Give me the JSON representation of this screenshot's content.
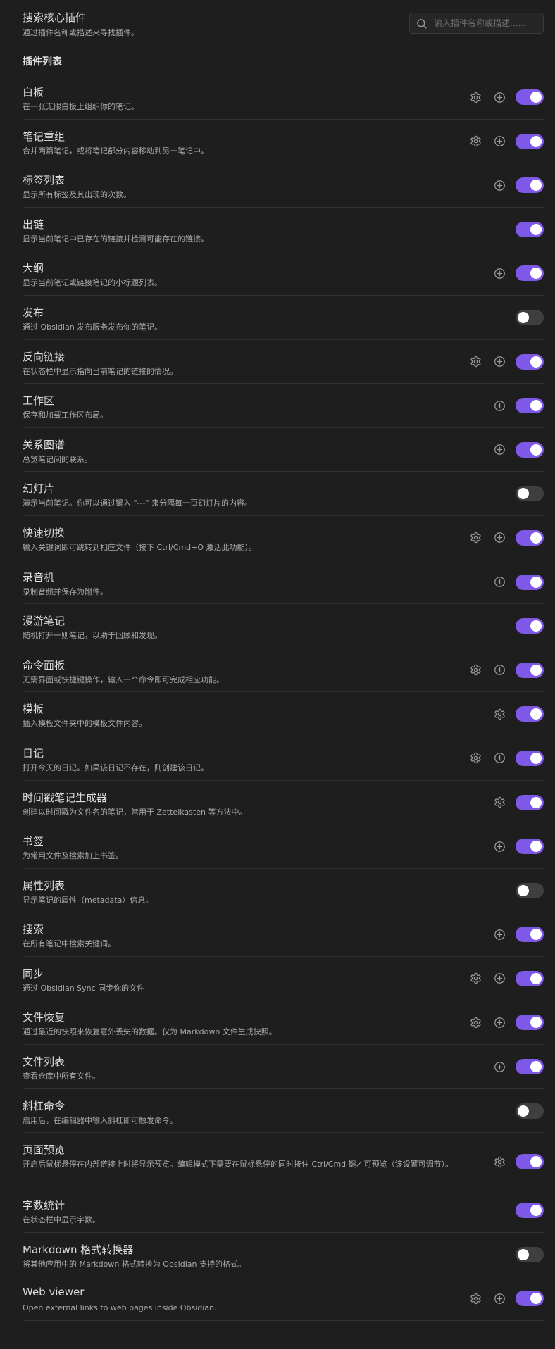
{
  "colors": {
    "background": "#1e1e1e",
    "accent": "#7e58e6",
    "toggle_off": "#3f3f3f",
    "divider": "#343434"
  },
  "search": {
    "title": "搜索核心插件",
    "description": "通过插件名称或描述来寻找插件。",
    "placeholder": "输入插件名称或描述......",
    "value": "",
    "icon": "search-icon"
  },
  "list_heading": "插件列表",
  "plugins": [
    {
      "name": "白板",
      "desc": "在一张无限白板上组织你的笔记。",
      "settings": true,
      "add": true,
      "enabled": true
    },
    {
      "name": "笔记重组",
      "desc": "合并两篇笔记，或将笔记部分内容移动到另一笔记中。",
      "settings": true,
      "add": true,
      "enabled": true
    },
    {
      "name": "标签列表",
      "desc": "显示所有标签及其出现的次数。",
      "settings": false,
      "add": true,
      "enabled": true
    },
    {
      "name": "出链",
      "desc": "显示当前笔记中已存在的链接并检测可能存在的链接。",
      "settings": false,
      "add": false,
      "enabled": true
    },
    {
      "name": "大纲",
      "desc": "显示当前笔记或链接笔记的小标题列表。",
      "settings": false,
      "add": true,
      "enabled": true
    },
    {
      "name": "发布",
      "desc": "通过 Obsidian 发布服务发布你的笔记。",
      "settings": false,
      "add": false,
      "enabled": false
    },
    {
      "name": "反向链接",
      "desc": "在状态栏中显示指向当前笔记的链接的情况。",
      "settings": true,
      "add": true,
      "enabled": true
    },
    {
      "name": "工作区",
      "desc": "保存和加载工作区布局。",
      "settings": false,
      "add": true,
      "enabled": true
    },
    {
      "name": "关系图谱",
      "desc": "总览笔记间的联系。",
      "settings": false,
      "add": true,
      "enabled": true
    },
    {
      "name": "幻灯片",
      "desc": "演示当前笔记。你可以通过键入 \"---\" 来分隔每一页幻灯片的内容。",
      "settings": false,
      "add": false,
      "enabled": false
    },
    {
      "name": "快速切换",
      "desc": "输入关键词即可跳转到相应文件（按下 Ctrl/Cmd+O 激活此功能）。",
      "settings": true,
      "add": true,
      "enabled": true
    },
    {
      "name": "录音机",
      "desc": "录制音频并保存为附件。",
      "settings": false,
      "add": true,
      "enabled": true
    },
    {
      "name": "漫游笔记",
      "desc": "随机打开一则笔记，以助于回顾和发现。",
      "settings": false,
      "add": false,
      "enabled": true
    },
    {
      "name": "命令面板",
      "desc": "无需界面或快捷键操作，输入一个命令即可完成相应功能。",
      "settings": true,
      "add": true,
      "enabled": true
    },
    {
      "name": "模板",
      "desc": "插入模板文件夹中的模板文件内容。",
      "settings": true,
      "add": false,
      "enabled": true
    },
    {
      "name": "日记",
      "desc": "打开今天的日记。如果该日记不存在，则创建该日记。",
      "settings": true,
      "add": true,
      "enabled": true
    },
    {
      "name": "时间戳笔记生成器",
      "desc": "创建以时间戳为文件名的笔记，常用于 Zettelkasten 等方法中。",
      "settings": true,
      "add": false,
      "enabled": true
    },
    {
      "name": "书签",
      "desc": "为常用文件及搜索加上书签。",
      "settings": false,
      "add": true,
      "enabled": true
    },
    {
      "name": "属性列表",
      "desc": "显示笔记的属性（metadata）信息。",
      "settings": false,
      "add": false,
      "enabled": false
    },
    {
      "name": "搜索",
      "desc": "在所有笔记中搜索关键词。",
      "settings": false,
      "add": true,
      "enabled": true
    },
    {
      "name": "同步",
      "desc": "通过 Obsidian Sync 同步你的文件",
      "settings": true,
      "add": true,
      "enabled": true
    },
    {
      "name": "文件恢复",
      "desc": "通过最近的快照来恢复意外丢失的数据。仅为 Markdown 文件生成快照。",
      "settings": true,
      "add": true,
      "enabled": true
    },
    {
      "name": "文件列表",
      "desc": "查看仓库中所有文件。",
      "settings": false,
      "add": true,
      "enabled": true
    },
    {
      "name": "斜杠命令",
      "desc": "启用后，在编辑器中输入斜杠即可触发命令。",
      "settings": false,
      "add": false,
      "enabled": false
    },
    {
      "name": "页面预览",
      "desc": "开启后鼠标悬停在内部链接上时将显示预览。编辑模式下需要在鼠标悬停的同时按住 Ctrl/Cmd 键才可预览（该设置可调节）。",
      "settings": true,
      "add": false,
      "enabled": true,
      "tall": true
    },
    {
      "name": "字数统计",
      "desc": "在状态栏中显示字数。",
      "settings": false,
      "add": false,
      "enabled": true
    },
    {
      "name": "Markdown 格式转换器",
      "desc": "将其他应用中的 Markdown 格式转换为 Obsidian 支持的格式。",
      "settings": false,
      "add": false,
      "enabled": false
    },
    {
      "name": "Web viewer",
      "desc": "Open external links to web pages inside Obsidian.",
      "settings": true,
      "add": true,
      "enabled": true
    }
  ]
}
